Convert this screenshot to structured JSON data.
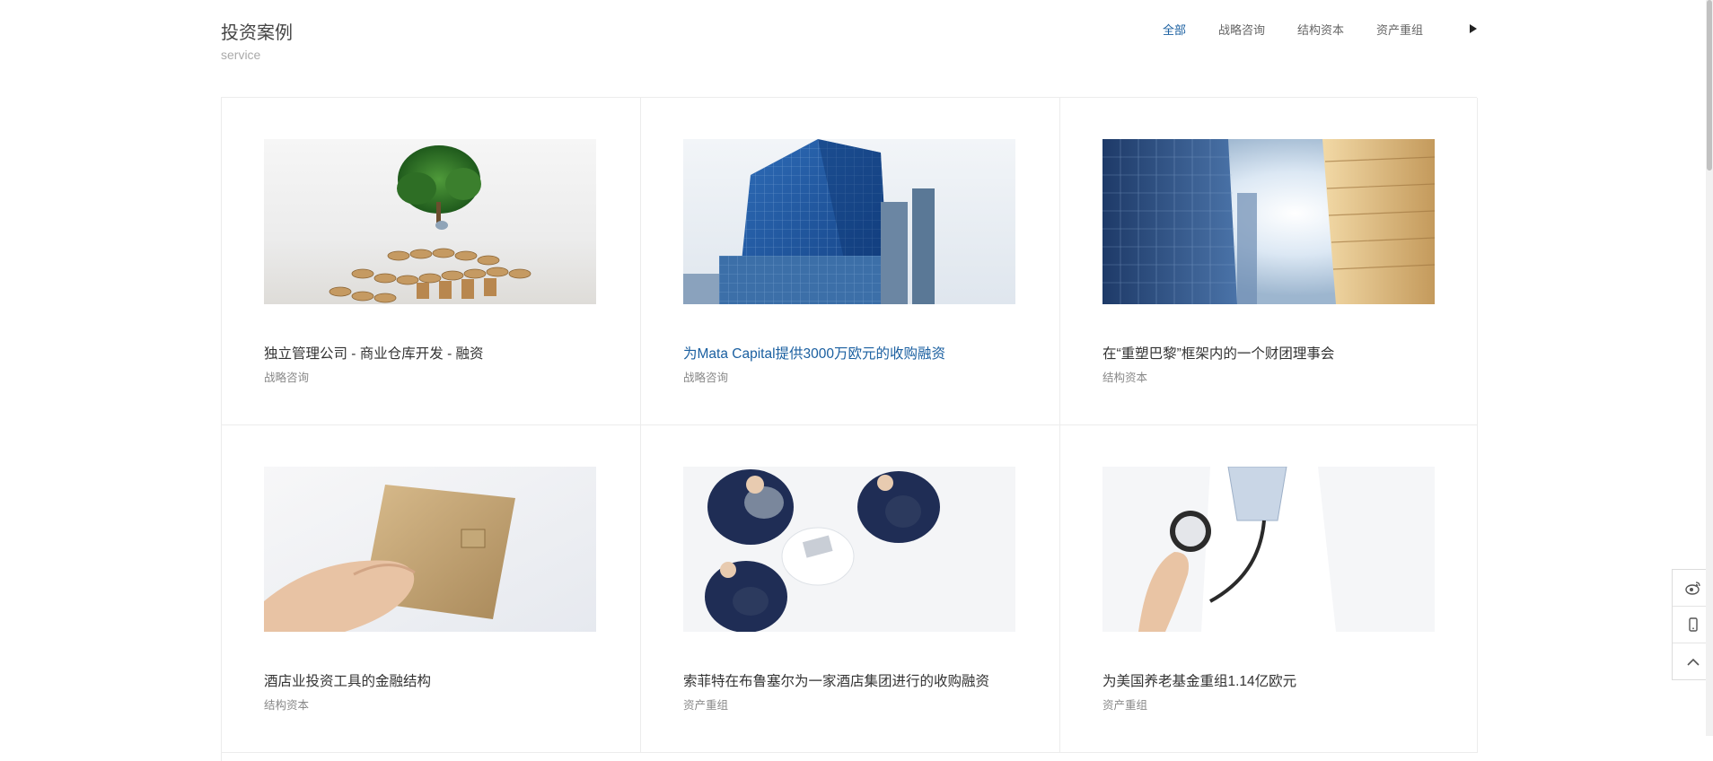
{
  "header": {
    "title": "投资案例",
    "subtitle": "service",
    "tabs": [
      {
        "label": "全部",
        "active": true
      },
      {
        "label": "战略咨询",
        "active": false
      },
      {
        "label": "结构资本",
        "active": false
      },
      {
        "label": "资产重组",
        "active": false
      }
    ],
    "next_icon": "play-triangle-icon"
  },
  "cases": [
    {
      "title": "独立管理公司 - 商业仓库开发 - 融资",
      "category": "战略咨询",
      "image": "tree-and-coins"
    },
    {
      "title": "为Mata Capital提供3000万欧元的收购融资",
      "category": "战略咨询",
      "image": "blue-glass-skyscraper"
    },
    {
      "title": "在“重塑巴黎”框架内的一个财团理事会",
      "category": "结构资本",
      "image": "buildings-sunlight"
    },
    {
      "title": "酒店业投资工具的金融结构",
      "category": "结构资本",
      "image": "hand-holding-card"
    },
    {
      "title": "索菲特在布鲁塞尔为一家酒店集团进行的收购融资",
      "category": "资产重组",
      "image": "business-meeting"
    },
    {
      "title": "为美国养老基金重组1.14亿欧元",
      "category": "资产重组",
      "image": "doctor-stethoscope"
    }
  ],
  "side_tools": [
    {
      "icon": "weibo-icon"
    },
    {
      "icon": "mobile-phone-icon"
    },
    {
      "icon": "chevron-up-icon"
    }
  ],
  "colors": {
    "accent": "#1a5fa0",
    "border": "#ececec",
    "text": "#333333",
    "muted": "#888888"
  }
}
